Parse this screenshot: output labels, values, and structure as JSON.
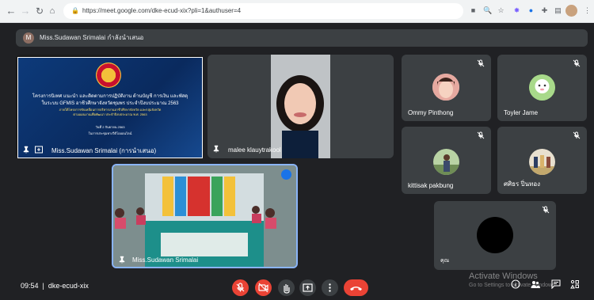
{
  "browser": {
    "url": "https://meet.google.com/dke-ecud-xix?pli=1&authuser=4"
  },
  "presenter_bar": {
    "avatar_letter": "M",
    "text": "Miss.Sudawan Srimalai กำลังนำเสนอ"
  },
  "slide": {
    "line1": "โครงการนิเทศ แนะนำ และติดตามการปฏิบัติงาน ด้านบัญชี การเงิน และพัสดุ",
    "line2": "ในระบบ GFMIS อาชีวศึกษาจังหวัดชุมพร ประจำปีงบประมาณ 2563",
    "line3": "ภายใต้โครงการขับเคลื่อนการบริหารงานอาชีวศึกษาจังหวัด และกลุ่มจังหวัด",
    "line4": "ตามแผนงานเพื่อพัฒนา ประจำปีงบประมาณ พ.ศ. 2563",
    "line5": "วันที่ 2 กันยายน 2563",
    "line6": "ในการประชุมทางวีดีโอออนไลน์"
  },
  "tiles": {
    "presentation_label": "Miss.Sudawan Srimalai (การนำเสนอ)",
    "malee": "malee klauytrakool",
    "local": "Miss.Sudawan Srimalai",
    "ommy": "Ommy Pinthong",
    "toyler": "Toyler Jame",
    "kittisak": "kittisak pakbung",
    "thai_user": "ศศิธร ปิ่นทอง",
    "you": "คุณ"
  },
  "bottom": {
    "time": "09:54",
    "separator": "|",
    "meeting_code": "dke-ecud-xix"
  },
  "watermark": {
    "line1": "Activate Windows",
    "line2": "Go to Settings to activate Windows."
  },
  "colors": {
    "background": "#202124",
    "tile": "#3c4043",
    "red": "#ea4335",
    "speaking_border": "#8ab4f8"
  }
}
